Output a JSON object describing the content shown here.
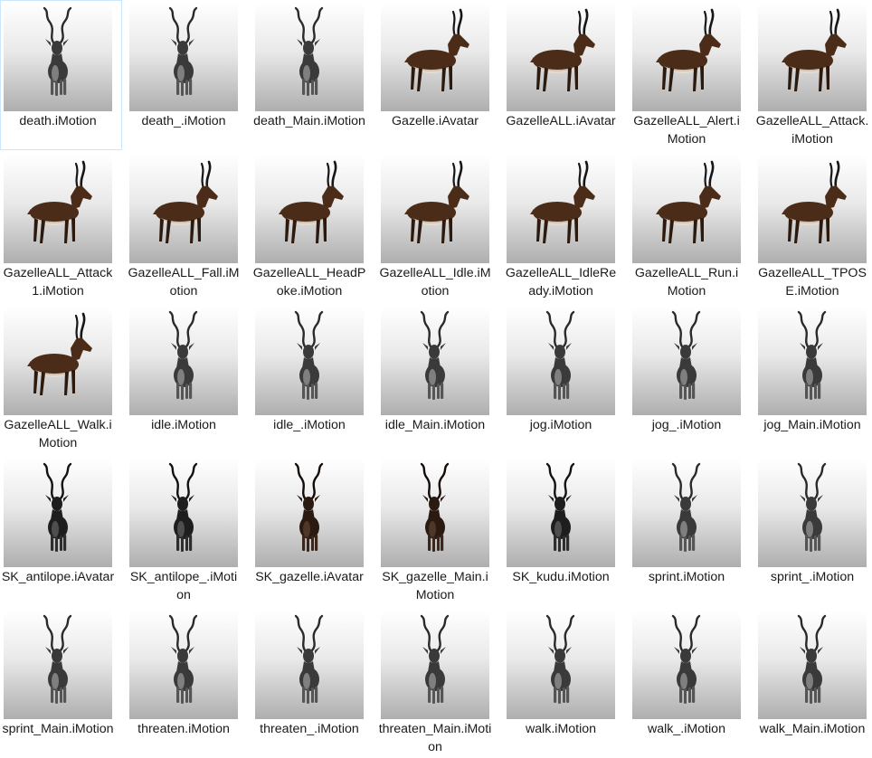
{
  "files": [
    {
      "name": "death.iMotion",
      "thumb": "front",
      "style": "pale",
      "selected": true
    },
    {
      "name": "death_.iMotion",
      "thumb": "front",
      "style": "pale"
    },
    {
      "name": "death_Main.iMotion",
      "thumb": "front",
      "style": "pale"
    },
    {
      "name": "Gazelle.iAvatar",
      "thumb": "side",
      "style": "brown"
    },
    {
      "name": "GazelleALL.iAvatar",
      "thumb": "side",
      "style": "brown"
    },
    {
      "name": "GazelleALL_Alert.iMotion",
      "thumb": "side",
      "style": "brown"
    },
    {
      "name": "GazelleALL_Attack.iMotion",
      "thumb": "side",
      "style": "brown"
    },
    {
      "name": "GazelleALL_Attack1.iMotion",
      "thumb": "side",
      "style": "brown"
    },
    {
      "name": "GazelleALL_Fall.iMotion",
      "thumb": "side",
      "style": "brown"
    },
    {
      "name": "GazelleALL_HeadPoke.iMotion",
      "thumb": "side",
      "style": "brown"
    },
    {
      "name": "GazelleALL_Idle.iMotion",
      "thumb": "side",
      "style": "brown"
    },
    {
      "name": "GazelleALL_IdleReady.iMotion",
      "thumb": "side",
      "style": "brown"
    },
    {
      "name": "GazelleALL_Run.iMotion",
      "thumb": "side",
      "style": "brown"
    },
    {
      "name": "GazelleALL_TPOSE.iMotion",
      "thumb": "side",
      "style": "brown"
    },
    {
      "name": "GazelleALL_Walk.iMotion",
      "thumb": "side",
      "style": "brown"
    },
    {
      "name": "idle.iMotion",
      "thumb": "front",
      "style": "pale"
    },
    {
      "name": "idle_.iMotion",
      "thumb": "front",
      "style": "pale"
    },
    {
      "name": "idle_Main.iMotion",
      "thumb": "front",
      "style": "pale"
    },
    {
      "name": "jog.iMotion",
      "thumb": "front",
      "style": "pale"
    },
    {
      "name": "jog_.iMotion",
      "thumb": "front",
      "style": "pale"
    },
    {
      "name": "jog_Main.iMotion",
      "thumb": "front",
      "style": "pale"
    },
    {
      "name": "SK_antilope.iAvatar",
      "thumb": "front",
      "style": "dark"
    },
    {
      "name": "SK_antilope_.iMotion",
      "thumb": "front",
      "style": "dark"
    },
    {
      "name": "SK_gazelle.iAvatar",
      "thumb": "front",
      "style": "darkbrown"
    },
    {
      "name": "SK_gazelle_Main.iMotion",
      "thumb": "front",
      "style": "darkbrown"
    },
    {
      "name": "SK_kudu.iMotion",
      "thumb": "front",
      "style": "dark"
    },
    {
      "name": "sprint.iMotion",
      "thumb": "front",
      "style": "pale"
    },
    {
      "name": "sprint_.iMotion",
      "thumb": "front",
      "style": "pale"
    },
    {
      "name": "sprint_Main.iMotion",
      "thumb": "front",
      "style": "pale"
    },
    {
      "name": "threaten.iMotion",
      "thumb": "front",
      "style": "pale"
    },
    {
      "name": "threaten_.iMotion",
      "thumb": "front",
      "style": "pale"
    },
    {
      "name": "threaten_Main.iMotion",
      "thumb": "front",
      "style": "pale"
    },
    {
      "name": "walk.iMotion",
      "thumb": "front",
      "style": "pale"
    },
    {
      "name": "walk_.iMotion",
      "thumb": "front",
      "style": "pale"
    },
    {
      "name": "walk_Main.iMotion",
      "thumb": "front",
      "style": "pale"
    }
  ]
}
